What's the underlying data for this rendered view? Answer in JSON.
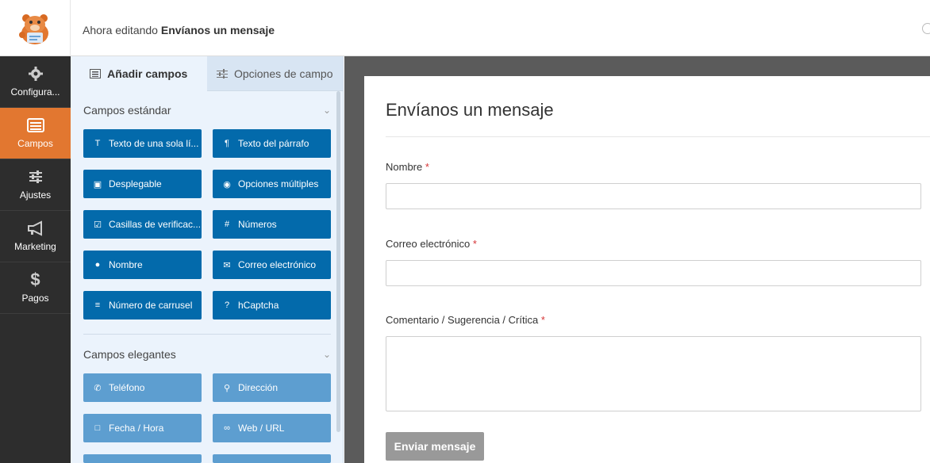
{
  "header": {
    "editing_prefix": "Ahora editando",
    "form_name": "Envíanos un mensaje"
  },
  "sidebar": {
    "items": [
      {
        "label": "Configura...",
        "icon": "gear-icon",
        "active": false
      },
      {
        "label": "Campos",
        "icon": "fields-list-icon",
        "active": true
      },
      {
        "label": "Ajustes",
        "icon": "sliders-icon",
        "active": false
      },
      {
        "label": "Marketing",
        "icon": "megaphone-icon",
        "active": false
      },
      {
        "label": "Pagos",
        "icon": "dollar-icon",
        "active": false
      }
    ]
  },
  "panel": {
    "tabs": [
      {
        "label": "Añadir campos",
        "icon": "list-icon"
      },
      {
        "label": "Opciones de campo",
        "icon": "sliders-icon"
      }
    ],
    "standard_title": "Campos estándar",
    "standard_fields": [
      {
        "label": "Texto de una sola lí...",
        "icon": "text-cursor-icon"
      },
      {
        "label": "Texto del párrafo",
        "icon": "pilcrow-icon"
      },
      {
        "label": "Desplegable",
        "icon": "dropdown-icon"
      },
      {
        "label": "Opciones múltiples",
        "icon": "radio-icon"
      },
      {
        "label": "Casillas de verificac...",
        "icon": "checkbox-icon"
      },
      {
        "label": "Números",
        "icon": "hash-icon"
      },
      {
        "label": "Nombre",
        "icon": "user-icon"
      },
      {
        "label": "Correo electrónico",
        "icon": "envelope-icon"
      },
      {
        "label": "Número de carrusel",
        "icon": "sliders-icon"
      },
      {
        "label": "hCaptcha",
        "icon": "question-circle-icon"
      }
    ],
    "fancy_title": "Campos elegantes",
    "fancy_fields": [
      {
        "label": "Teléfono",
        "icon": "phone-icon"
      },
      {
        "label": "Dirección",
        "icon": "map-pin-icon"
      },
      {
        "label": "Fecha / Hora",
        "icon": "calendar-icon"
      },
      {
        "label": "Web / URL",
        "icon": "link-icon"
      }
    ]
  },
  "form": {
    "title": "Envíanos un mensaje",
    "fields": [
      {
        "label": "Nombre",
        "required_mark": "*"
      },
      {
        "label": "Correo electrónico",
        "required_mark": "*"
      },
      {
        "label": "Comentario / Sugerencia / Crítica",
        "required_mark": "*"
      }
    ],
    "submit_label": "Enviar mensaje"
  },
  "colors": {
    "accent_orange": "#e27730",
    "standard_button": "#036aab",
    "fancy_button": "#5d9ed0",
    "sidebar_bg": "#2d2d2d",
    "panel_bg": "#ebf3fc"
  }
}
